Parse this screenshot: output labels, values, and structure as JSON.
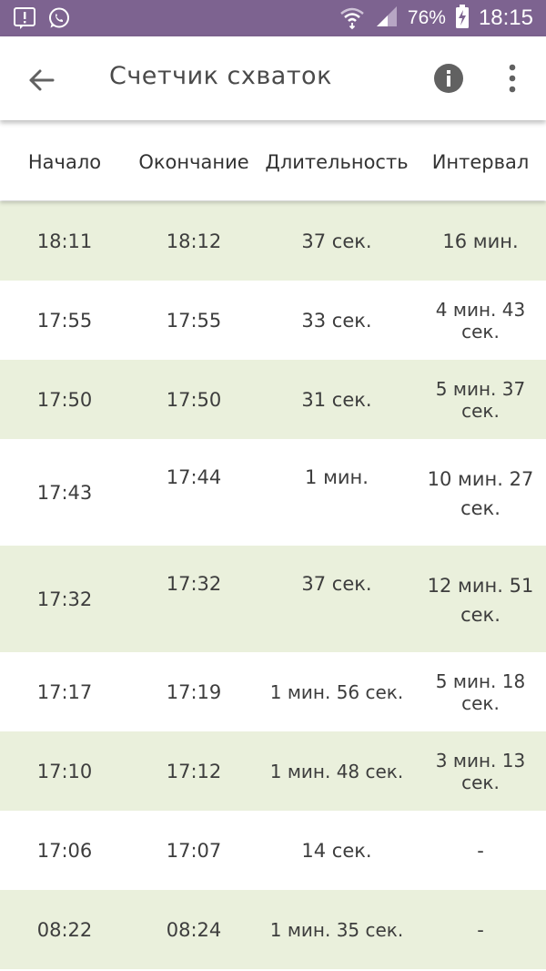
{
  "status_bar": {
    "battery": "76%",
    "time": "18:15",
    "icons": [
      "notification-alert-icon",
      "whatsapp-icon",
      "wifi-icon",
      "signal-icon",
      "battery-charging-icon"
    ]
  },
  "app_bar": {
    "title": "Счетчик схваток",
    "icons": [
      "back-arrow-icon",
      "info-icon",
      "more-vert-icon"
    ]
  },
  "table": {
    "headers": [
      "Начало",
      "Окончание",
      "Длительность",
      "Интервал"
    ],
    "rows": [
      {
        "start": "18:11",
        "end": "18:12",
        "duration": "37 сек.",
        "interval": "16 мин."
      },
      {
        "start": "17:55",
        "end": "17:55",
        "duration": "33 сек.",
        "interval": "4 мин. 43 сек."
      },
      {
        "start": "17:50",
        "end": "17:50",
        "duration": "31 сек.",
        "interval": "5 мин. 37 сек."
      },
      {
        "start": "17:43",
        "end": "17:44",
        "duration": "1 мин.",
        "interval": "10 мин. 27 сек."
      },
      {
        "start": "17:32",
        "end": "17:32",
        "duration": "37 сек.",
        "interval": "12 мин. 51 сек."
      },
      {
        "start": "17:17",
        "end": "17:19",
        "duration": "1 мин. 56 сек.",
        "interval": "5 мин. 18 сек."
      },
      {
        "start": "17:10",
        "end": "17:12",
        "duration": "1 мин. 48 сек.",
        "interval": "3 мин. 13 сек."
      },
      {
        "start": "17:06",
        "end": "17:07",
        "duration": "14 сек.",
        "interval": "-"
      },
      {
        "start": "08:22",
        "end": "08:24",
        "duration": "1 мин. 35 сек.",
        "interval": "-"
      }
    ]
  },
  "colors": {
    "status_bar": "#7d6390",
    "row_alt": "#eaf0dc",
    "row_plain": "#ffffff"
  }
}
